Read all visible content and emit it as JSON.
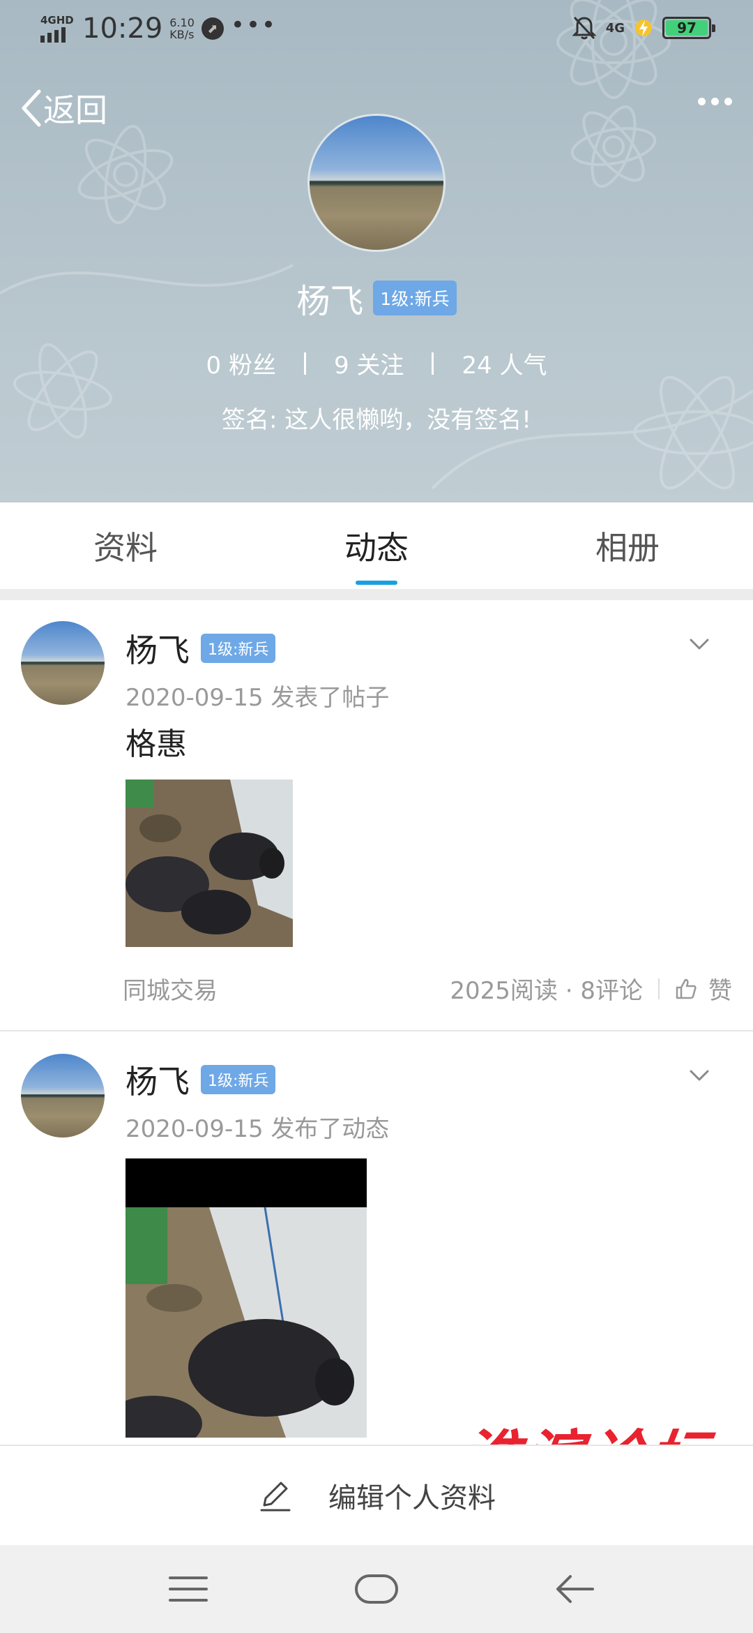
{
  "status_bar": {
    "network": "4GHD",
    "time": "10:29",
    "speed_value": "6.10",
    "speed_unit": "KB/s",
    "more": "•••",
    "signal_right": "4G",
    "battery": "97"
  },
  "header": {
    "back_label": "返回",
    "username": "杨飞",
    "level_badge": "1级:新兵",
    "stats": {
      "fans": "0 粉丝",
      "following": "9 关注",
      "popularity": "24 人气"
    },
    "signature": "签名: 这人很懒哟，没有签名!"
  },
  "tabs": [
    {
      "label": "资料",
      "active": false
    },
    {
      "label": "动态",
      "active": true
    },
    {
      "label": "相册",
      "active": false
    }
  ],
  "posts": [
    {
      "author": "杨飞",
      "badge": "1级:新兵",
      "date": "2020-09-15",
      "action": "发表了帖子",
      "title": "格惠",
      "category": "同城交易",
      "stats": "2025阅读 · 8评论",
      "like_label": "赞"
    },
    {
      "author": "杨飞",
      "badge": "1级:新兵",
      "date": "2020-09-15",
      "action": "发布了动态"
    }
  ],
  "edit_bar": {
    "label": "编辑个人资料"
  },
  "watermark": "淮滨论坛",
  "icons": {
    "back": "chevron-left-icon",
    "more": "more-dots-icon",
    "expand": "chevron-down-icon",
    "like": "thumbs-up-icon",
    "edit": "pencil-icon",
    "nav_menu": "menu-icon",
    "nav_home": "home-icon",
    "nav_back": "back-arrow-icon"
  },
  "colors": {
    "accent": "#1aa0e0",
    "badge": "#6ea8e6",
    "watermark": "#e8232f",
    "battery": "#42d17a"
  }
}
